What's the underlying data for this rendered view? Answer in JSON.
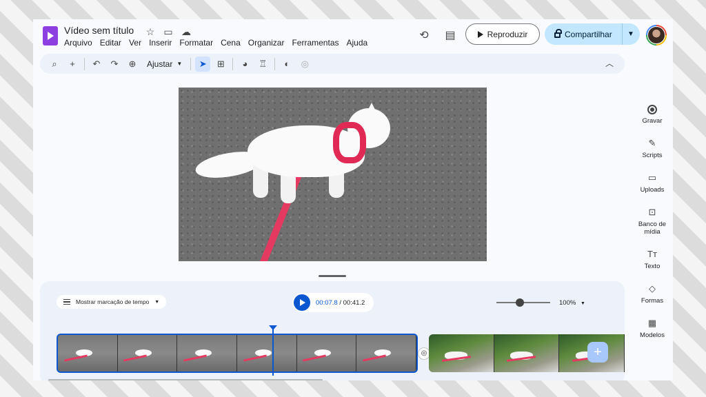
{
  "header": {
    "title": "Vídeo sem título",
    "menu": [
      "Arquivo",
      "Editar",
      "Ver",
      "Inserir",
      "Formatar",
      "Cena",
      "Organizar",
      "Ferramentas",
      "Ajuda"
    ],
    "play_label": "Reproduzir",
    "share_label": "Compartilhar"
  },
  "toolbar": {
    "zoom_label": "Ajustar"
  },
  "timeline": {
    "show_timestamps_label": "Mostrar marcação de tempo",
    "current_time": "00:07.8",
    "total_time": " / 00:41.2",
    "zoom_percent": "100%"
  },
  "side_panel": {
    "items": [
      {
        "label": "Gravar",
        "icon": "record-icon"
      },
      {
        "label": "Scripts",
        "icon": "script-icon"
      },
      {
        "label": "Uploads",
        "icon": "folder-icon"
      },
      {
        "label": "Banco de mídia",
        "icon": "media-library-icon"
      },
      {
        "label": "Texto",
        "icon": "text-icon"
      },
      {
        "label": "Formas",
        "icon": "shapes-icon"
      },
      {
        "label": "Modelos",
        "icon": "templates-icon"
      }
    ]
  },
  "colors": {
    "accent": "#0b57d0",
    "share_bg": "#c2e7ff",
    "logo": "#8e3fe0"
  }
}
